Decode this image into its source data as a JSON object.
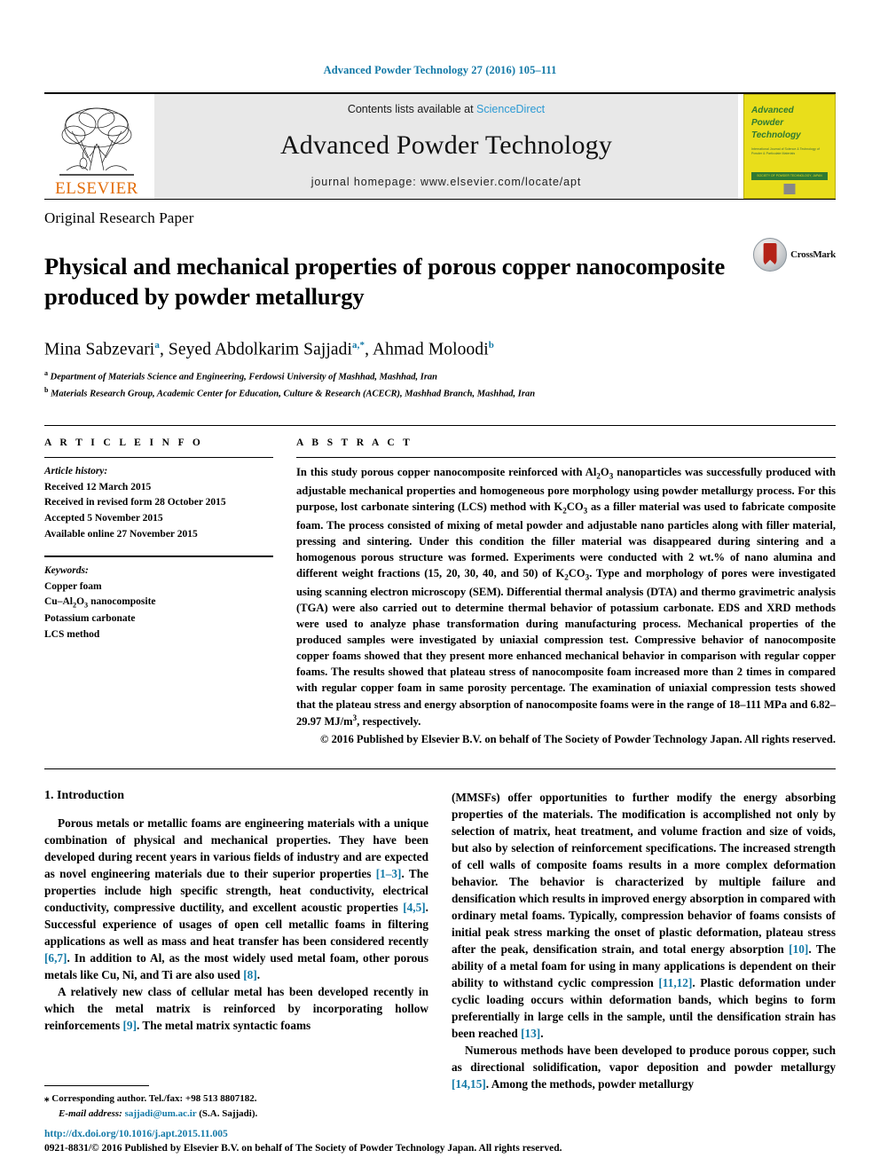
{
  "running_head": "Advanced Powder Technology 27 (2016) 105–111",
  "masthead": {
    "publisher": "ELSEVIER",
    "contents_prefix": "Contents lists available at ",
    "contents_link": "ScienceDirect",
    "journal_name": "Advanced Powder Technology",
    "homepage": "journal homepage: www.elsevier.com/locate/apt",
    "cover": {
      "line1": "Advanced",
      "line2": "Powder",
      "line3": "Technology",
      "subtitle": "International Journal of Science & Technology of Powder & Particulate Materials",
      "bar_text": "SOCIETY OF POWDER TECHNOLOGY, JAPAN"
    }
  },
  "article": {
    "type": "Original Research Paper",
    "title": "Physical and mechanical properties of porous copper nanocomposite produced by powder metallurgy",
    "crossmark_label": "CrossMark",
    "authors": [
      {
        "name": "Mina Sabzevari",
        "marks": "a"
      },
      {
        "name": "Seyed Abdolkarim Sajjadi",
        "marks": "a,*"
      },
      {
        "name": "Ahmad Moloodi",
        "marks": "b"
      }
    ],
    "affiliations": [
      {
        "mark": "a",
        "text": "Department of Materials Science and Engineering, Ferdowsi University of Mashhad, Mashhad, Iran"
      },
      {
        "mark": "b",
        "text": "Materials Research Group, Academic Center for Education, Culture & Research (ACECR), Mashhad Branch, Mashhad, Iran"
      }
    ]
  },
  "article_info": {
    "heading": "A R T I C L E  I N F O",
    "history_label": "Article history:",
    "history": [
      "Received 12 March 2015",
      "Received in revised form 28 October 2015",
      "Accepted 5 November 2015",
      "Available online 27 November 2015"
    ],
    "keywords_label": "Keywords:",
    "keywords": [
      "Copper foam",
      "Cu–Al2O3 nanocomposite",
      "Potassium carbonate",
      "LCS method"
    ]
  },
  "abstract": {
    "heading": "A B S T R A C T",
    "text_part1": "In this study porous copper nanocomposite reinforced with Al",
    "text_sub1": "2",
    "text_part2": "O",
    "text_sub2": "3",
    "text_part3": " nanoparticles was successfully produced with adjustable mechanical properties and homogeneous pore morphology using powder metallurgy process. For this purpose, lost carbonate sintering (LCS) method with K",
    "text_sub3": "2",
    "text_part4": "CO",
    "text_sub4": "3",
    "text_part5": " as a filler material was used to fabricate composite foam. The process consisted of mixing of metal powder and adjustable nano particles along with filler material, pressing and sintering. Under this condition the filler material was disappeared during sintering and a homogenous porous structure was formed. Experiments were conducted with 2 wt.% of nano alumina and different weight fractions (15, 20, 30, 40, and 50) of K",
    "text_sub5": "2",
    "text_part6": "CO",
    "text_sub6": "3",
    "text_part7": ". Type and morphology of pores were investigated using scanning electron microscopy (SEM). Differential thermal analysis (DTA) and thermo gravimetric analysis (TGA) were also carried out to determine thermal behavior of potassium carbonate. EDS and XRD methods were used to analyze phase transformation during manufacturing process. Mechanical properties of the produced samples were investigated by uniaxial compression test. Compressive behavior of nanocomposite copper foams showed that they present more enhanced mechanical behavior in comparison with regular copper foams. The results showed that plateau stress of nanocomposite foam increased more than 2 times in compared with regular copper foam in same porosity percentage. The examination of uniaxial compression tests showed that the plateau stress and energy absorption of nanocomposite foams were in the range of 18–111 MPa and 6.82–29.97 MJ/m",
    "text_sup1": "3",
    "text_part8": ", respectively.",
    "copyright": "© 2016 Published by Elsevier B.V. on behalf of The Society of Powder Technology Japan. All rights reserved."
  },
  "introduction": {
    "section_number_title": "1. Introduction",
    "left_p1_a": "Porous metals or metallic foams are engineering materials with a unique combination of physical and mechanical properties. They have been developed during recent years in various fields of industry and are expected as novel engineering materials due to their superior properties ",
    "left_p1_c1": "[1–3]",
    "left_p1_b": ". The properties include high specific strength, heat conductivity, electrical conductivity, compressive ductility, and excellent acoustic properties ",
    "left_p1_c2": "[4,5]",
    "left_p1_d": ". Successful experience of usages of open cell metallic foams in filtering applications as well as mass and heat transfer has been considered recently ",
    "left_p1_c3": "[6,7]",
    "left_p1_e": ". In addition to Al, as the most widely used metal foam, other porous metals like Cu, Ni, and Ti are also used ",
    "left_p1_c4": "[8]",
    "left_p1_f": ".",
    "left_p2_a": "A relatively new class of cellular metal has been developed recently in which the metal matrix is reinforced by incorporating hollow reinforcements ",
    "left_p2_c1": "[9]",
    "left_p2_b": ". The metal matrix syntactic foams",
    "right_p1_a": "(MMSFs) offer opportunities to further modify the energy absorbing properties of the materials. The modification is accomplished not only by selection of matrix, heat treatment, and volume fraction and size of voids, but also by selection of reinforcement specifications. The increased strength of cell walls of composite foams results in a more complex deformation behavior. The behavior is characterized by multiple failure and densification which results in improved energy absorption in compared with ordinary metal foams. Typically, compression behavior of foams consists of initial peak stress marking the onset of plastic deformation, plateau stress after the peak, densification strain, and total energy absorption ",
    "right_p1_c1": "[10]",
    "right_p1_b": ". The ability of a metal foam for using in many applications is dependent on their ability to withstand cyclic compression ",
    "right_p1_c2": "[11,12]",
    "right_p1_c": ". Plastic deformation under cyclic loading occurs within deformation bands, which begins to form preferentially in large cells in the sample, until the densification strain has been reached ",
    "right_p1_c3": "[13]",
    "right_p1_d": ".",
    "right_p2_a": "Numerous methods have been developed to produce porous copper, such as directional solidification, vapor deposition and powder metallurgy ",
    "right_p2_c1": "[14,15]",
    "right_p2_b": ". Among the methods, powder metallurgy"
  },
  "footnote": {
    "corresponding": "⁎ Corresponding author. Tel./fax: +98 513 8807182.",
    "email_label": "E-mail address:",
    "email": "sajjadi@um.ac.ir",
    "email_suffix": " (S.A. Sajjadi)."
  },
  "footer": {
    "doi": "http://dx.doi.org/10.1016/j.apt.2015.11.005",
    "issn": "0921-8831/© 2016 Published by Elsevier B.V. on behalf of The Society of Powder Technology Japan. All rights reserved."
  }
}
